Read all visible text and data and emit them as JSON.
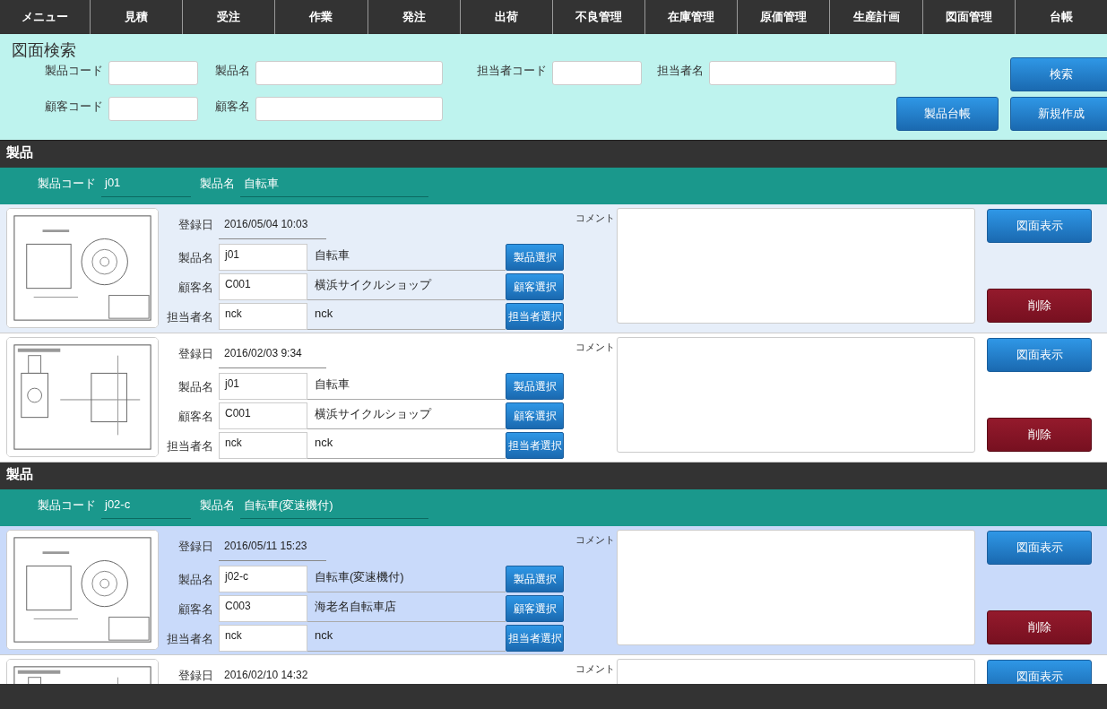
{
  "menu": [
    {
      "label": "メニュー"
    },
    {
      "label": "見積"
    },
    {
      "label": "受注"
    },
    {
      "label": "作業"
    },
    {
      "label": "発注"
    },
    {
      "label": "出荷"
    },
    {
      "label": "不良管理"
    },
    {
      "label": "在庫管理"
    },
    {
      "label": "原価管理"
    },
    {
      "label": "生産計画"
    },
    {
      "label": "図面管理"
    },
    {
      "label": "台帳"
    }
  ],
  "search": {
    "title": "図面検索",
    "fields": [
      [
        {
          "label": "製品コード"
        },
        {
          "label": "製品名"
        },
        {
          "label": "担当者コード"
        },
        {
          "label": "担当者名"
        }
      ],
      [
        {
          "label": "顧客コード"
        },
        {
          "label": "顧客名"
        }
      ]
    ],
    "buttons": [
      "検索",
      "製品台帳",
      "新規作成"
    ]
  },
  "groups": [
    {
      "title": "製品",
      "code_label": "製品コード",
      "code": "j01",
      "name_label": "製品名",
      "name": "自転車",
      "drawings": [
        {
          "selected": false,
          "registered_label": "登録日",
          "registered": "2016/05/04 10:03",
          "fields": [
            {
              "label": "製品名",
              "code": "j01",
              "name": "自転車",
              "button": "製品選択"
            },
            {
              "label": "顧客名",
              "code": "C001",
              "name": "横浜サイクルショップ",
              "button": "顧客選択"
            },
            {
              "label": "担当者名",
              "code": "nck",
              "name": "nck",
              "button": "担当者選択"
            }
          ],
          "comment_label": "コメント",
          "view_button": "図面表示",
          "delete_button": "削除"
        },
        {
          "selected": false,
          "registered_label": "登録日",
          "registered": "2016/02/03 9:34",
          "fields": [
            {
              "label": "製品名",
              "code": "j01",
              "name": "自転車",
              "button": "製品選択"
            },
            {
              "label": "顧客名",
              "code": "C001",
              "name": "横浜サイクルショップ",
              "button": "顧客選択"
            },
            {
              "label": "担当者名",
              "code": "nck",
              "name": "nck",
              "button": "担当者選択"
            }
          ],
          "comment_label": "コメント",
          "view_button": "図面表示",
          "delete_button": "削除"
        }
      ]
    },
    {
      "title": "製品",
      "code_label": "製品コード",
      "code": "j02-c",
      "name_label": "製品名",
      "name": "自転車(変速機付)",
      "drawings": [
        {
          "selected": true,
          "registered_label": "登録日",
          "registered": "2016/05/11 15:23",
          "fields": [
            {
              "label": "製品名",
              "code": "j02-c",
              "name": "自転車(変速機付)",
              "button": "製品選択"
            },
            {
              "label": "顧客名",
              "code": "C003",
              "name": "海老名自転車店",
              "button": "顧客選択"
            },
            {
              "label": "担当者名",
              "code": "nck",
              "name": "nck",
              "button": "担当者選択"
            }
          ],
          "comment_label": "コメント",
          "view_button": "図面表示",
          "delete_button": "削除"
        },
        {
          "selected": false,
          "registered_label": "登録日",
          "registered": "2016/02/10 14:32",
          "comment_label": "コメント",
          "view_button": "図面表示"
        }
      ]
    }
  ]
}
